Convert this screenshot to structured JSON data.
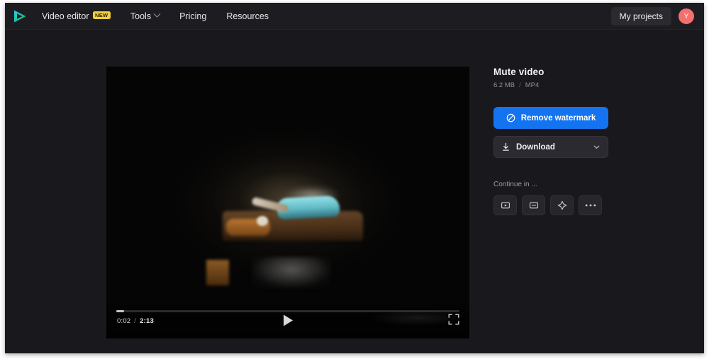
{
  "header": {
    "logo_icon": "play-logo-icon",
    "nav": [
      {
        "label": "Video editor",
        "badge": "NEW",
        "icon": null
      },
      {
        "label": "Tools",
        "badge": null,
        "icon": "chevron-down-icon"
      },
      {
        "label": "Pricing",
        "badge": null,
        "icon": null
      },
      {
        "label": "Resources",
        "badge": null,
        "icon": null
      }
    ],
    "my_projects_label": "My projects",
    "avatar_initial": "Y"
  },
  "player": {
    "current_time": "0:02",
    "time_separator": "/",
    "total_time": "2:13",
    "progress_percent": 2.2,
    "play_icon": "play-icon",
    "fullscreen_icon": "fullscreen-icon"
  },
  "sidebar": {
    "title": "Mute video",
    "file_size": "6.2 MB",
    "meta_divider": "/",
    "file_format": "MP4",
    "remove_watermark_label": "Remove watermark",
    "remove_watermark_icon": "no-watermark-icon",
    "download_label": "Download",
    "download_icon": "download-icon",
    "download_chevron_icon": "chevron-down-icon",
    "continue_label": "Continue in ...",
    "continue_tools": [
      {
        "name": "video-player-tool",
        "icon": "video-play-box-icon"
      },
      {
        "name": "subtitle-tool",
        "icon": "caption-box-icon"
      },
      {
        "name": "ai-effects-tool",
        "icon": "sparkle-icon"
      },
      {
        "name": "more-tools",
        "icon": "ellipsis-icon"
      }
    ]
  },
  "colors": {
    "accent_blue": "#1473f0",
    "badge_yellow": "#f2cf3f",
    "avatar_red": "#f3706f",
    "page_bg": "#19191d",
    "header_bg": "#1d1d21"
  }
}
